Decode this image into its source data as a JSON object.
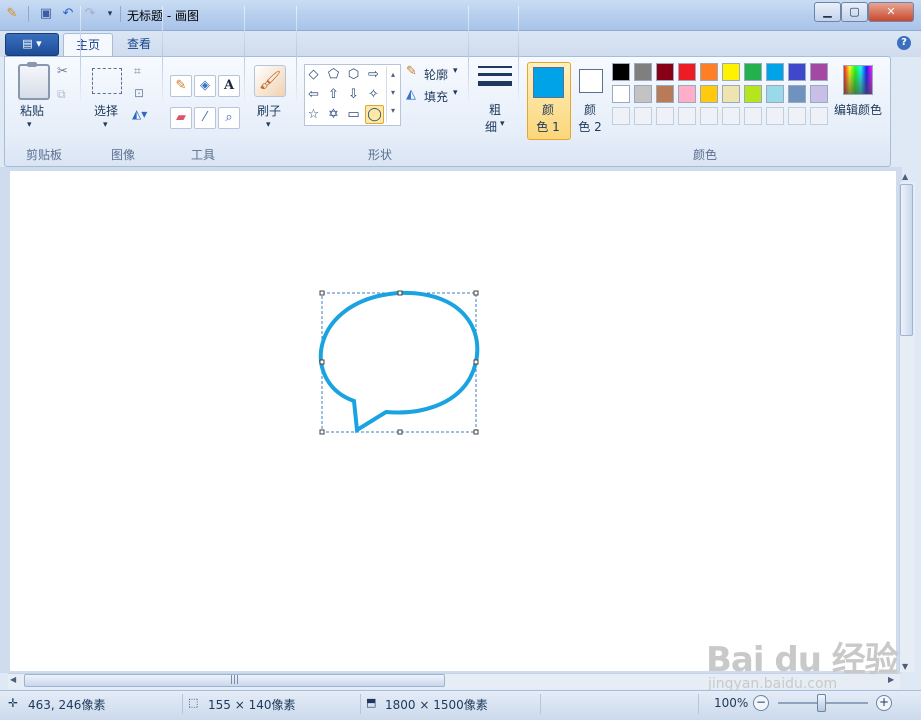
{
  "window": {
    "title": "无标题 - 画图",
    "quick_access": [
      "paint-app-icon",
      "save-icon",
      "undo-icon",
      "redo-icon",
      "customize-arrow-icon"
    ]
  },
  "tabs": {
    "app_menu": "▤ ▾",
    "home": "主页",
    "view": "查看",
    "help": "?"
  },
  "clipboard": {
    "paste_label": "粘贴",
    "group_label": "剪贴板"
  },
  "image": {
    "select_label": "选择",
    "group_label": "图像"
  },
  "tools": {
    "group_label": "工具"
  },
  "brushes": {
    "label": "刷子"
  },
  "shapes": {
    "outline_label": "轮廓",
    "fill_label": "填充",
    "group_label": "形状",
    "selected_shape": "oval-callout"
  },
  "size": {
    "label_top": "粗",
    "label_bottom": "细"
  },
  "colors": {
    "color1_label_top": "颜",
    "color1_label_bottom": "色 1",
    "color2_label_top": "颜",
    "color2_label_bottom": "色 2",
    "color1_value": "#00a2e8",
    "color2_value": "#ffffff",
    "edit_colors_label": "编辑颜色",
    "group_label": "颜色",
    "palette_row1": [
      "#000000",
      "#7f7f7f",
      "#880015",
      "#ed1c24",
      "#ff7f27",
      "#fff200",
      "#22b14c",
      "#00a2e8",
      "#3f48cc",
      "#a349a4"
    ],
    "palette_row2": [
      "#ffffff",
      "#c3c3c3",
      "#b97a57",
      "#ffaec9",
      "#ffc90e",
      "#efe4b0",
      "#b5e61d",
      "#99d9ea",
      "#7092be",
      "#c8bfe7"
    ]
  },
  "canvas": {
    "shape": "speech-bubble",
    "stroke_color": "#1aa3e0"
  },
  "status": {
    "cursor_pos": "463, 246像素",
    "selection_size": "155 × 140像素",
    "image_size": "1800 × 1500像素",
    "zoom": "100%"
  },
  "watermark": {
    "brand": "Bai du 经验",
    "url": "jingyan.baidu.com"
  }
}
